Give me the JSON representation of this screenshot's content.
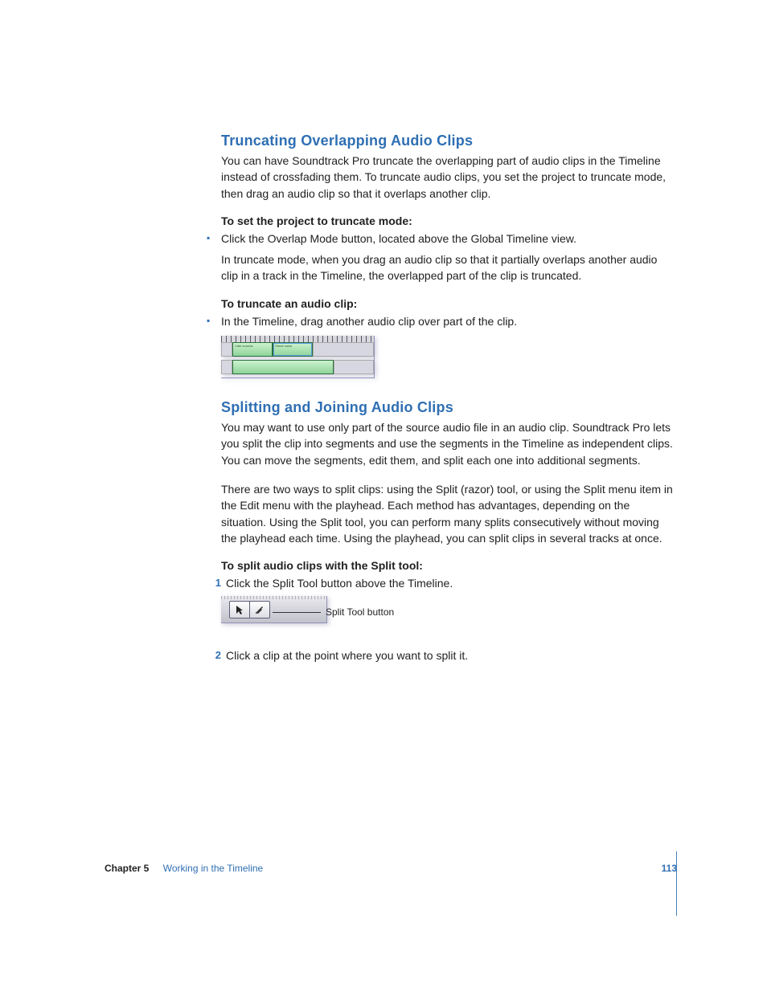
{
  "sections": {
    "truncating": {
      "title": "Truncating Overlapping Audio Clips",
      "intro": "You can have Soundtrack Pro truncate the overlapping part of audio clips in the Timeline instead of crossfading them. To truncate audio clips, you set the project to truncate mode, then drag an audio clip so that it overlaps another clip.",
      "lead1": "To set the project to truncate mode:",
      "bullet1": "Click the Overlap Mode button, located above the Global Timeline view.",
      "cont1": "In truncate mode, when you drag an audio clip so that it partially overlaps another audio clip in a track in the Timeline, the overlapped part of the clip is truncated.",
      "lead2": "To truncate an audio clip:",
      "bullet2": "In the Timeline, drag another audio clip over part of the clip."
    },
    "splitting": {
      "title": "Splitting and Joining Audio Clips",
      "para1": "You may want to use only part of the source audio file in an audio clip. Soundtrack Pro lets you split the clip into segments and use the segments in the Timeline as independent clips. You can move the segments, edit them, and split each one into additional segments.",
      "para2": "There are two ways to split clips:  using the Split (razor) tool, or using the Split menu item in the Edit menu with the playhead. Each method has advantages, depending on the situation. Using the Split tool, you can perform many splits consecutively without moving the playhead each time. Using the playhead, you can split clips in several tracks at once.",
      "lead": "To split audio clips with the Split tool:",
      "step1": "Click the Split Tool button above the Timeline.",
      "callout": "Split Tool button",
      "step2": "Click a clip at the point where you want to split it."
    }
  },
  "fig1": {
    "clip_a": "Cafe sounds",
    "clip_b": "Street noise"
  },
  "footer": {
    "chapter_label": "Chapter 5",
    "chapter_title": "Working in the Timeline",
    "page_number": "113"
  },
  "steps": {
    "n1": "1",
    "n2": "2"
  }
}
